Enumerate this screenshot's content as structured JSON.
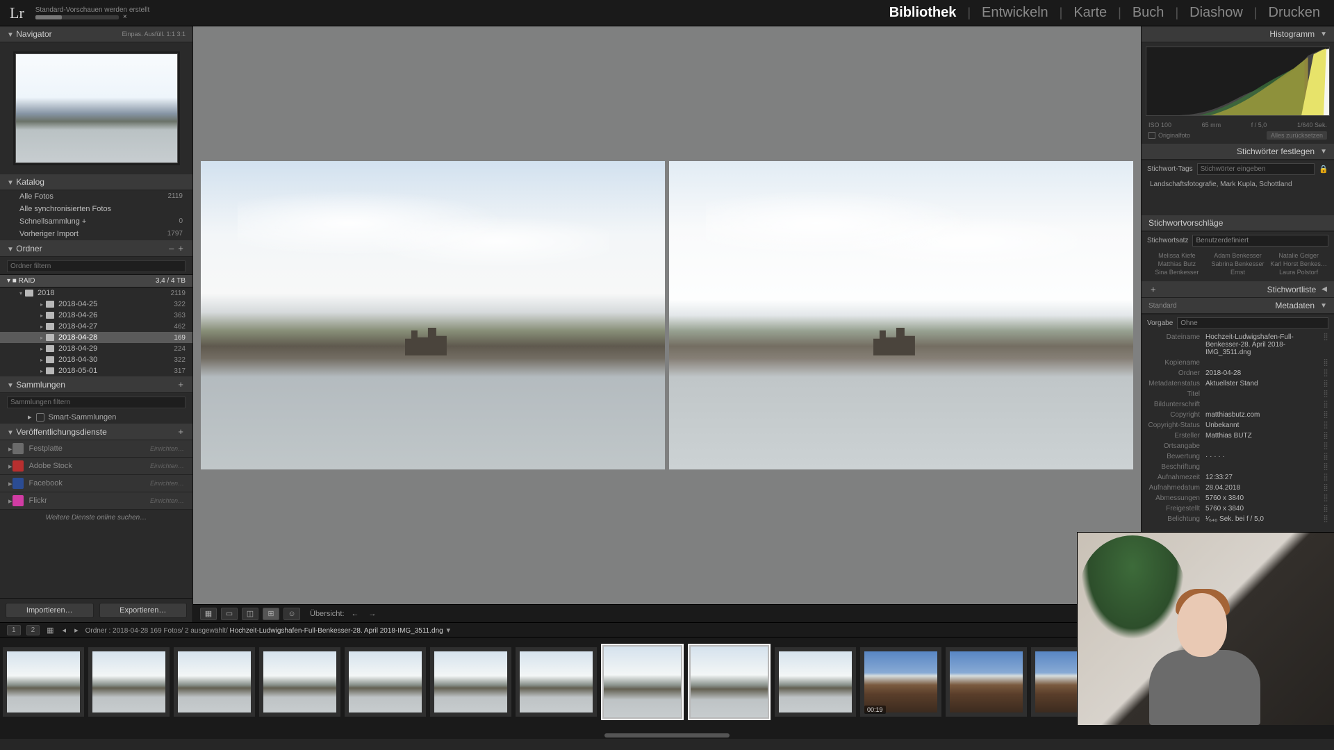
{
  "topbar": {
    "logo": "Lr",
    "progress_label": "Standard-Vorschauen werden erstellt",
    "modules": [
      "Bibliothek",
      "Entwickeln",
      "Karte",
      "Buch",
      "Diashow",
      "Drucken"
    ],
    "active_module": "Bibliothek"
  },
  "navigator": {
    "title": "Navigator",
    "zoom_labels": "Einpas.   Ausfüll.   1:1   3:1"
  },
  "catalog": {
    "title": "Katalog",
    "rows": [
      {
        "label": "Alle Fotos",
        "count": "2119"
      },
      {
        "label": "Alle synchronisierten Fotos",
        "count": ""
      },
      {
        "label": "Schnellsammlung  +",
        "count": "0"
      },
      {
        "label": "Vorheriger Import",
        "count": "1797"
      }
    ]
  },
  "folders": {
    "title": "Ordner",
    "search_placeholder": "Ordner filtern",
    "volume": {
      "name": "RAID",
      "usage": "3,4 / 4 TB"
    },
    "year": {
      "name": "2018",
      "count": "2119"
    },
    "dates": [
      {
        "name": "2018-04-25",
        "count": "322"
      },
      {
        "name": "2018-04-26",
        "count": "363"
      },
      {
        "name": "2018-04-27",
        "count": "462"
      },
      {
        "name": "2018-04-28",
        "count": "169",
        "selected": true
      },
      {
        "name": "2018-04-29",
        "count": "224"
      },
      {
        "name": "2018-04-30",
        "count": "322"
      },
      {
        "name": "2018-05-01",
        "count": "317"
      }
    ]
  },
  "collections": {
    "title": "Sammlungen",
    "search_placeholder": "Sammlungen filtern",
    "smart": "Smart-Sammlungen"
  },
  "publish": {
    "title": "Veröffentlichungsdienste",
    "services": [
      {
        "name": "Festplatte",
        "icon": "#6b6b6b"
      },
      {
        "name": "Adobe Stock",
        "icon": "#b82f2f"
      },
      {
        "name": "Facebook",
        "icon": "#2b4c93"
      },
      {
        "name": "Flickr",
        "icon": "#d13ca4"
      }
    ],
    "setup_label": "Einrichten…",
    "more": "Weitere Dienste online suchen…"
  },
  "impexp": {
    "import": "Importieren…",
    "export": "Exportieren…"
  },
  "toolbar": {
    "overview_label": "Übersicht:"
  },
  "right": {
    "histogram_title": "Histogramm",
    "histo_meta": {
      "iso": "ISO 100",
      "focal": "65 mm",
      "aperture": "f / 5,0",
      "shutter": "1/640 Sek."
    },
    "orig": "Originalfoto",
    "reset": "Alles zurücksetzen"
  },
  "keywords": {
    "panel_title": "Stichwörter festlegen",
    "tags_label": "Stichwort-Tags",
    "tags_placeholder": "Stichwörter eingeben",
    "applied": "Landschaftsfotografie, Mark Kupla, Schottland",
    "suggestions_title": "Stichwortvorschläge",
    "set_label": "Stichwortsatz",
    "set_value": "Benutzerdefiniert",
    "suggestions": [
      "Melissa Kiefe",
      "Adam Benkesser",
      "Natalie Geiger",
      "Matthias Butz",
      "Sabrina Benkesser",
      "Karl Horst Benkesser",
      "Sina Benkesser",
      "Ernst",
      "Laura Polstorf"
    ],
    "list_title": "Stichwortliste"
  },
  "metadata": {
    "panel_title": "Metadaten",
    "preset_label": "Vorgabe",
    "preset_value": "Ohne",
    "rows": [
      {
        "lbl": "Dateiname",
        "val": "Hochzeit-Ludwigshafen-Full-Benkesser-28. April 2018-IMG_3511.dng"
      },
      {
        "lbl": "Kopiename",
        "val": ""
      },
      {
        "lbl": "Ordner",
        "val": "2018-04-28"
      },
      {
        "lbl": "Metadatenstatus",
        "val": "Aktuellster Stand"
      },
      {
        "lbl": "Titel",
        "val": ""
      },
      {
        "lbl": "Bildunterschrift",
        "val": ""
      },
      {
        "lbl": "Copyright",
        "val": "matthiasbutz.com"
      },
      {
        "lbl": "Copyright-Status",
        "val": "Unbekannt"
      },
      {
        "lbl": "Ersteller",
        "val": "Matthias BUTZ"
      },
      {
        "lbl": "Ortsangabe",
        "val": ""
      },
      {
        "lbl": "Bewertung",
        "val": "·  ·  ·  ·  ·"
      },
      {
        "lbl": "Beschriftung",
        "val": ""
      },
      {
        "lbl": "Aufnahmezeit",
        "val": "12:33:27"
      },
      {
        "lbl": "Aufnahmedatum",
        "val": "28.04.2018"
      },
      {
        "lbl": "Abmessungen",
        "val": "5760 x 3840"
      },
      {
        "lbl": "Freigestellt",
        "val": "5760 x 3840"
      },
      {
        "lbl": "Belichtung",
        "val": "¹⁄₆₄₀ Sek. bei f / 5,0"
      }
    ]
  },
  "filmstrip": {
    "monitor1": "1",
    "monitor2": "2",
    "path_prefix": "Ordner : 2018-04-28   169 Fotos/ 2 ausgewählt/ ",
    "path_file": "Hochzeit-Ludwigshafen-Full-Benkesser-28. April 2018-IMG_3511.dng",
    "thumbs": [
      {
        "t": "a"
      },
      {
        "t": "a"
      },
      {
        "t": "a"
      },
      {
        "t": "a"
      },
      {
        "t": "a"
      },
      {
        "t": "a"
      },
      {
        "t": "a"
      },
      {
        "t": "a",
        "sel": true
      },
      {
        "t": "a",
        "sel": true
      },
      {
        "t": "a"
      },
      {
        "t": "b",
        "badge": "00:19"
      },
      {
        "t": "b"
      },
      {
        "t": "b"
      },
      {
        "t": "c"
      },
      {
        "t": "c"
      },
      {
        "t": "c"
      }
    ]
  }
}
